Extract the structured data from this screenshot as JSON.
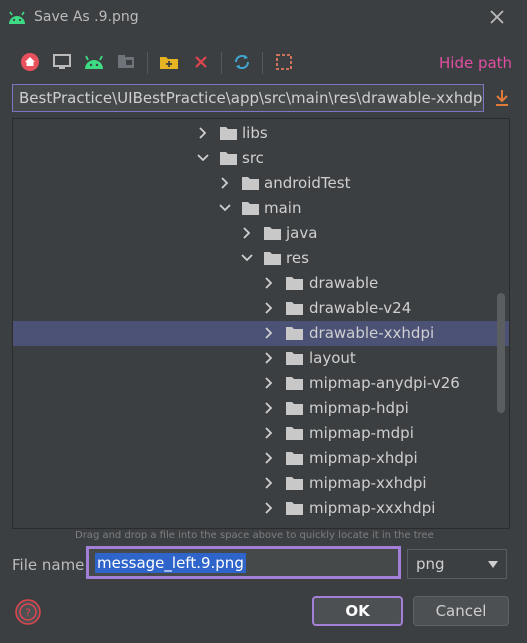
{
  "window": {
    "title": "Save As .9.png",
    "app_icon": "android-icon",
    "close_icon": "close-icon"
  },
  "toolbar": {
    "buttons": [
      {
        "icon": "home-icon",
        "color": "#e8505b"
      },
      {
        "icon": "desktop-icon",
        "color": "#bbbbbb"
      },
      {
        "icon": "android-icon",
        "color": "#3ddc84"
      },
      {
        "icon": "module-icon",
        "color": "#6f737a"
      },
      {
        "icon": "new-folder-icon",
        "color": "#e6b422"
      },
      {
        "icon": "delete-icon",
        "color": "#e0454f"
      },
      {
        "icon": "refresh-icon",
        "color": "#3fa9d6"
      },
      {
        "icon": "select-area-icon",
        "color": "#e07a5f"
      }
    ],
    "hide_path": "Hide path"
  },
  "path": {
    "value": "BestPractice\\UIBestPractice\\app\\src\\main\\res\\drawable-xxhdpi"
  },
  "tree": {
    "rows": [
      {
        "label": "libs",
        "expanded": false,
        "level": 0
      },
      {
        "label": "src",
        "expanded": true,
        "level": 0
      },
      {
        "label": "androidTest",
        "expanded": false,
        "level": 1
      },
      {
        "label": "main",
        "expanded": true,
        "level": 1
      },
      {
        "label": "java",
        "expanded": false,
        "level": 2
      },
      {
        "label": "res",
        "expanded": true,
        "level": 2
      },
      {
        "label": "drawable",
        "expanded": false,
        "level": 3
      },
      {
        "label": "drawable-v24",
        "expanded": false,
        "level": 3
      },
      {
        "label": "drawable-xxhdpi",
        "expanded": false,
        "level": 3,
        "selected": true
      },
      {
        "label": "layout",
        "expanded": false,
        "level": 3
      },
      {
        "label": "mipmap-anydpi-v26",
        "expanded": false,
        "level": 3
      },
      {
        "label": "mipmap-hdpi",
        "expanded": false,
        "level": 3
      },
      {
        "label": "mipmap-mdpi",
        "expanded": false,
        "level": 3
      },
      {
        "label": "mipmap-xhdpi",
        "expanded": false,
        "level": 3
      },
      {
        "label": "mipmap-xxhdpi",
        "expanded": false,
        "level": 3
      },
      {
        "label": "mipmap-xxxhdpi",
        "expanded": false,
        "level": 3
      }
    ]
  },
  "hint": "Drag and drop a file into the space above to quickly locate it in the tree",
  "file_name": {
    "label": "File name:",
    "value": "message_left.9.png"
  },
  "file_type": {
    "value": "png"
  },
  "buttons": {
    "ok": "OK",
    "cancel": "Cancel",
    "help_icon": "help-icon"
  },
  "colors": {
    "accent": "#a47fd8",
    "selection": "#4b5276",
    "link": "#e24fa2",
    "background": "#3c3f41"
  }
}
